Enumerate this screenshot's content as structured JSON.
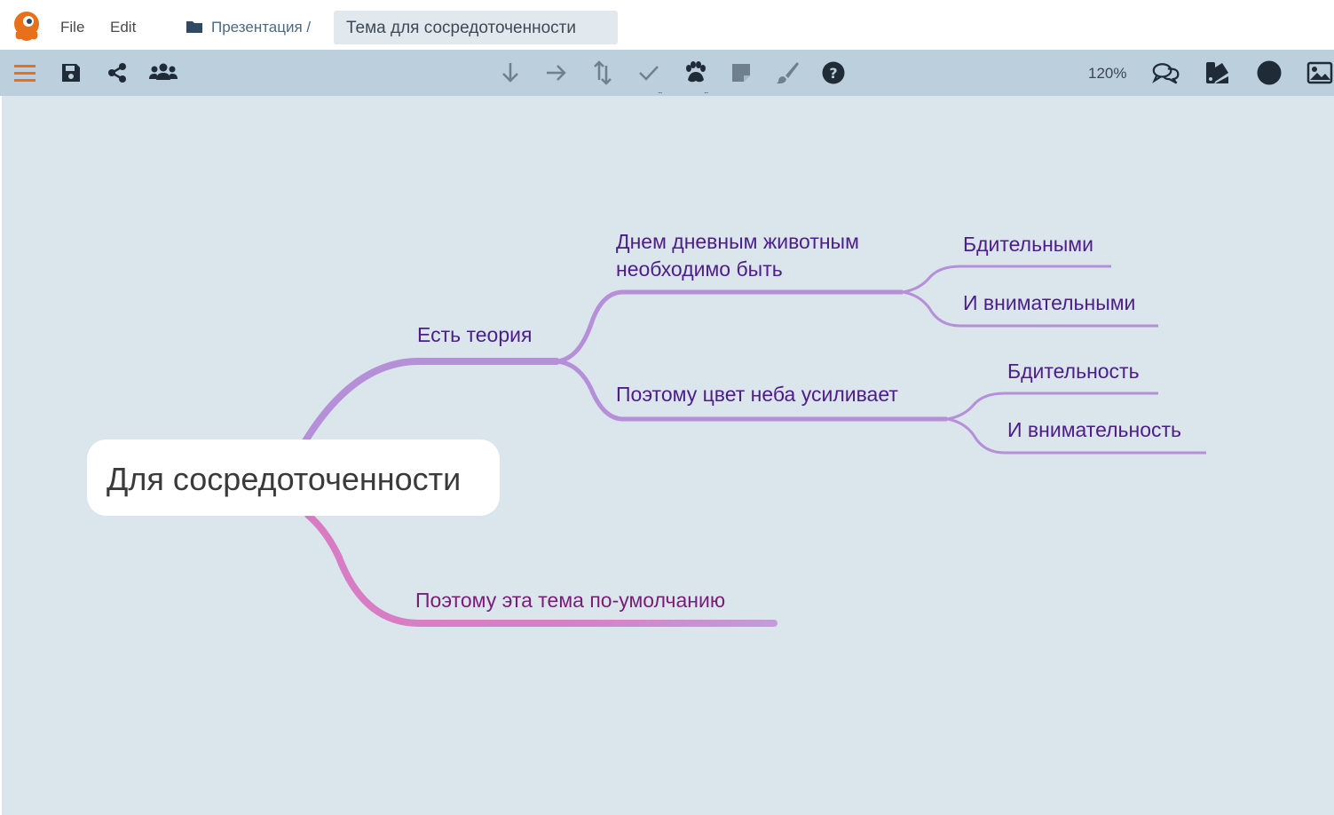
{
  "menu": {
    "file": "File",
    "edit": "Edit"
  },
  "breadcrumb": {
    "folder": "Презентация /",
    "document": "Тема для сосредоточенности"
  },
  "toolbar": {
    "zoom": "120%",
    "icons": [
      "menu-icon",
      "save-icon",
      "share-icon",
      "collaborators-icon",
      "arrow-down-icon",
      "arrow-right-icon",
      "swap-vertical-icon",
      "checkmark-icon",
      "paw-icon",
      "sticky-note-icon",
      "brush-icon",
      "help-icon",
      "comments-icon",
      "theme-icon",
      "circle-icon",
      "image-icon"
    ],
    "dots_label": "..."
  },
  "mindmap": {
    "central": "Для сосредоточенности",
    "theory": "Есть теория",
    "day_line1": "Днем дневным животным",
    "day_line2": "необходимо быть",
    "vigilant": "Бдительными",
    "attentive": "И внимательными",
    "sky": "Поэтому цвет неба усиливает",
    "vigilance": "Бдительность",
    "attention": "И внимательность",
    "default_theme": "Поэтому эта тема по-умолчанию"
  },
  "colors": {
    "accent": "#e8701a",
    "branch_purple": "#b58fd8",
    "branch_pink": "#d97bc2",
    "text_purple": "#4d1d8a",
    "text_pink": "#7a1d79",
    "canvas": "#dbe5ec",
    "toolbar": "#bccfdc"
  }
}
